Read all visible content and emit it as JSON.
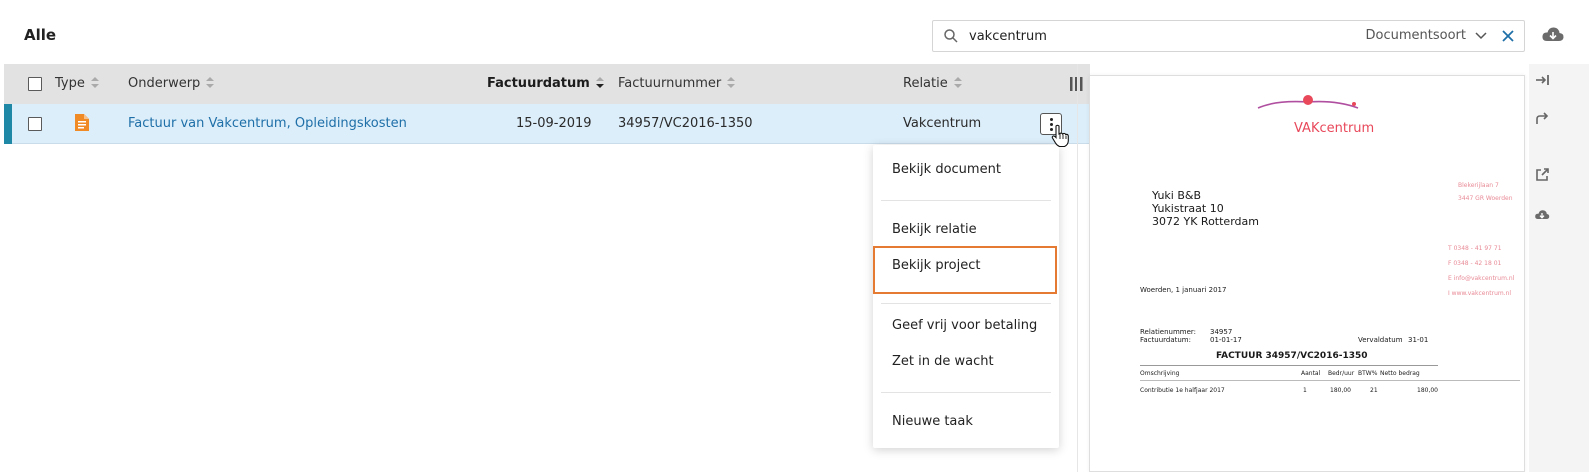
{
  "page": {
    "title": "Alle"
  },
  "search": {
    "value": "vakcentrum",
    "doctype_label": "Documentsoort"
  },
  "columns": {
    "type": "Type",
    "subject": "Onderwerp",
    "invoice_date": "Factuurdatum",
    "invoice_number": "Factuurnummer",
    "relation": "Relatie"
  },
  "rows": [
    {
      "subject": "Factuur van Vakcentrum, Opleidingskosten",
      "invoice_date": "15-09-2019",
      "invoice_number": "34957/VC2016-1350",
      "relation": "Vakcentrum"
    }
  ],
  "context_menu": {
    "items": [
      "Bekijk document",
      "Bekijk relatie",
      "Bekijk project",
      "Geef vrij voor betaling",
      "Zet in de wacht",
      "Nieuwe taak"
    ],
    "highlighted_index": 2
  },
  "preview": {
    "logo": "VAKcentrum",
    "addressee": [
      "Yuki B&B",
      "Yukistraat 10",
      "3072 YK Rotterdam"
    ],
    "sender_details": [
      "Blekerijlaan 7",
      "3447 GR Woerden",
      "T  0348 - 41 97 71",
      "F  0348 - 42 18 01",
      "E  info@vakcentrum.nl",
      "I   www.vakcentrum.nl"
    ],
    "place_date": "Woerden, 1 januari 2017",
    "relation_number_label": "Relatienummer:",
    "relation_number": "34957",
    "invoice_date_label": "Factuurdatum:",
    "invoice_date": "01-01-17",
    "due_label": "Vervaldatum",
    "due_date": "31-01",
    "heading": "FACTUUR 34957/VC2016-1350",
    "table_headers": [
      "Omschrijving",
      "Aantal",
      "Bedr/uur",
      "BTW%",
      "Netto bedrag"
    ],
    "line": [
      "Contributie 1e halfjaar 2017",
      "1",
      "180,00",
      "21",
      "180,00"
    ]
  },
  "colors": {
    "accent": "#1e6fa8",
    "row_selected": "#dceefa",
    "highlight_border": "#e57a32",
    "doc_icon": "#f08a24",
    "logo": "#b04fa0"
  }
}
